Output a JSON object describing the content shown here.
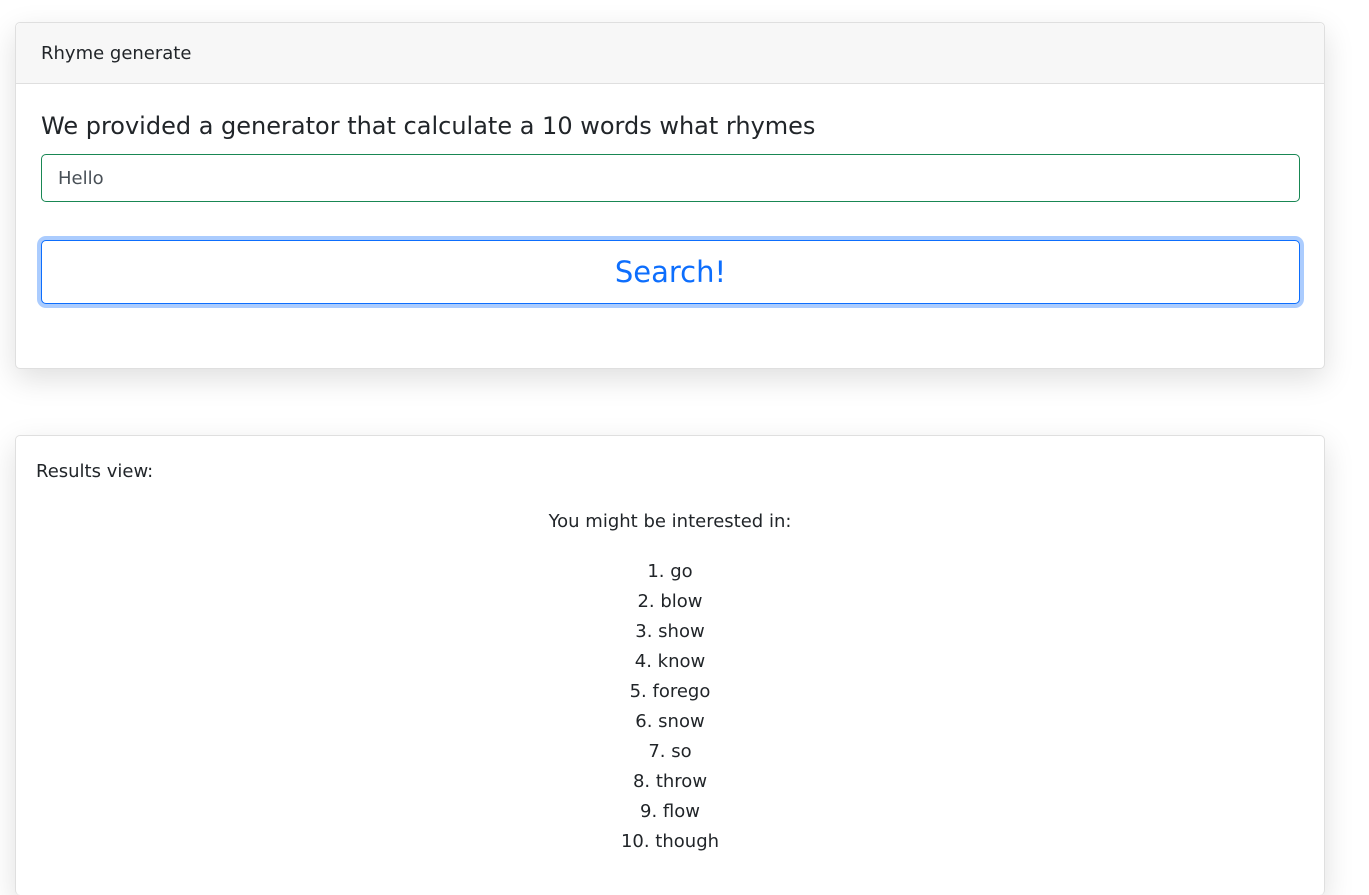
{
  "generator": {
    "header_title": "Rhyme generate",
    "prompt": "We provided a generator that calculate a 10 words what rhymes",
    "input_value": "Hello",
    "search_label": "Search!"
  },
  "results": {
    "label": "Results view:",
    "intro": "You might be interested in:",
    "items": [
      "1. go",
      "2. blow",
      "3. show",
      "4. know",
      "5. forego",
      "6. snow",
      "7. so",
      "8. throw",
      "9. flow",
      "10. though"
    ]
  },
  "colors": {
    "accent": "#0d6efd",
    "input_border": "#198754"
  }
}
